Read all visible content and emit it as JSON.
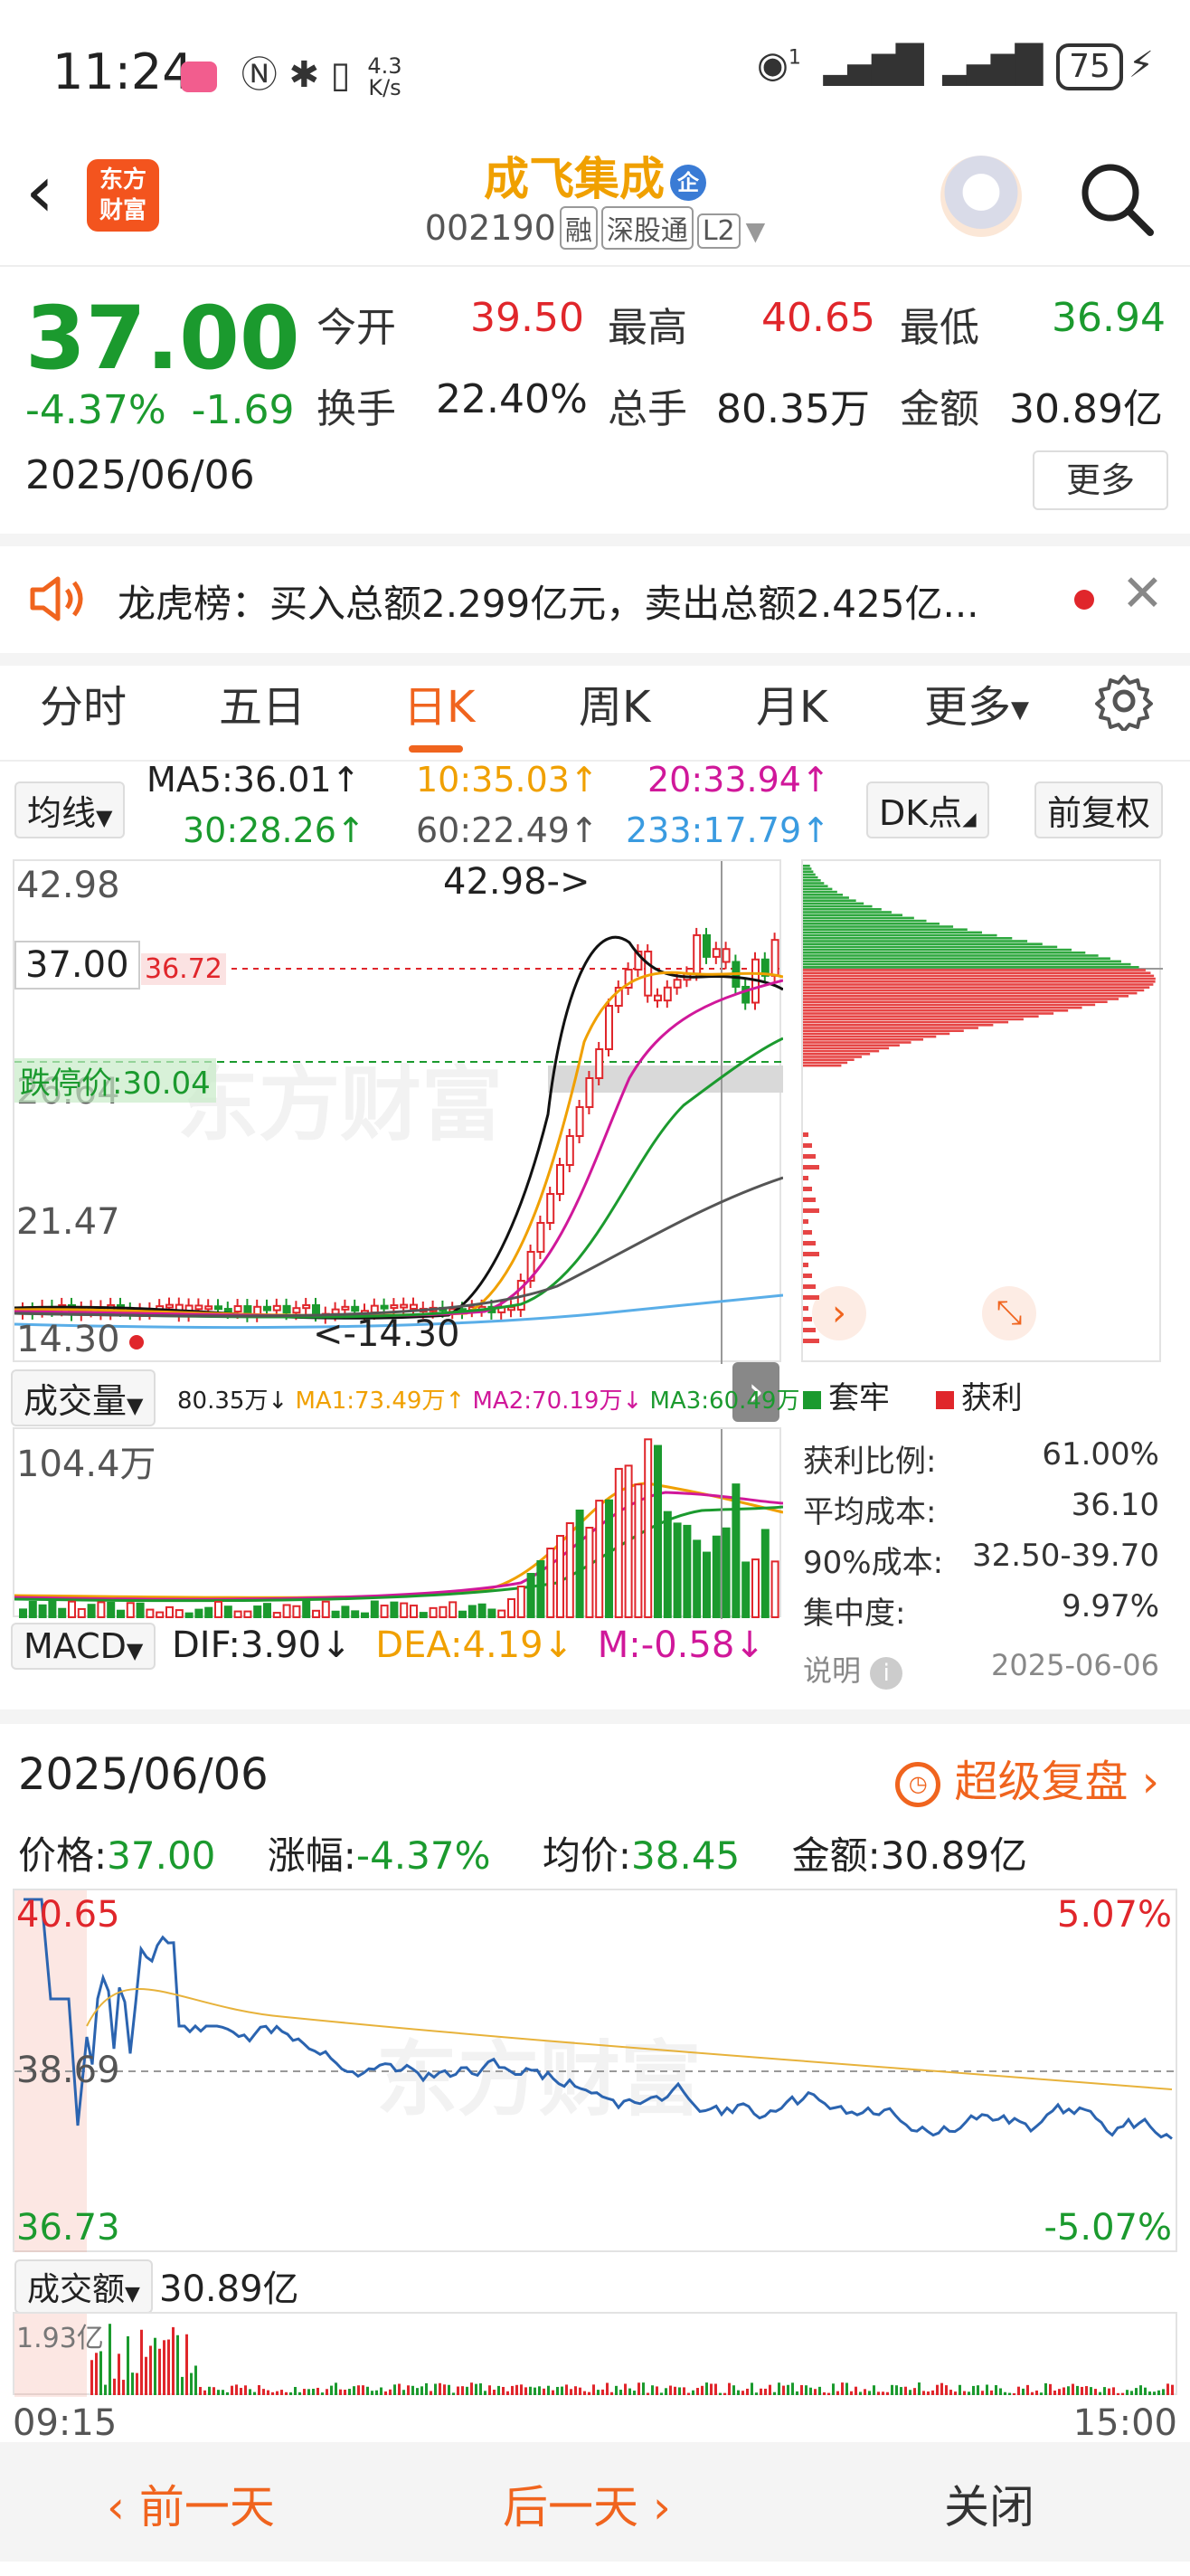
{
  "status_bar": {
    "time": "11:24",
    "speed_value": "4.3",
    "speed_unit": "K/s",
    "signal_tag": "1",
    "battery": "75"
  },
  "header": {
    "logo_line1": "东方",
    "logo_line2": "财富",
    "stock_name": "成飞集成",
    "badge": "企",
    "stock_code": "002190",
    "tags": [
      "融",
      "深股通",
      "L2"
    ]
  },
  "quote": {
    "price": "37.00",
    "change_pct": "-4.37%",
    "change_amt": "-1.69",
    "date": "2025/06/06",
    "open_label": "今开",
    "open": "39.50",
    "high_label": "最高",
    "high": "40.65",
    "low_label": "最低",
    "low": "36.94",
    "turnover_label": "换手",
    "turnover": "22.40%",
    "volume_label": "总手",
    "volume": "80.35万",
    "amount_label": "金额",
    "amount": "30.89亿",
    "more": "更多"
  },
  "news": {
    "text": "龙虎榜：买入总额2.299亿元，卖出总额2.425亿..."
  },
  "tabs": [
    "分时",
    "五日",
    "日K",
    "周K",
    "月K",
    "更多"
  ],
  "kchart": {
    "ma_select": "均线",
    "ma5": "MA5:36.01↑",
    "ma10": "10:35.03↑",
    "ma20": "20:33.94↑",
    "ma30": "30:28.26↑",
    "ma60": "60:22.49↑",
    "ma233": "233:17.79↑",
    "dk_btn": "DK点",
    "fq_btn": "前复权",
    "y_top": "42.98",
    "y_mid1": "26.64",
    "y_mid2": "21.47",
    "y_bottom": "14.30",
    "current_tag": "37.00",
    "current_tag2": "36.72",
    "limit_down": "跌停价:30.04",
    "high_mark": "42.98->",
    "low_mark": "<-14.30",
    "watermark": "东方财富"
  },
  "chip": {
    "legend_locked": "套牢",
    "legend_profit": "获利",
    "stats": [
      {
        "label": "获利比例:",
        "value": "61.00%"
      },
      {
        "label": "平均成本:",
        "value": "36.10"
      },
      {
        "label": "90%成本:",
        "value": "32.50-39.70"
      },
      {
        "label": "集中度:",
        "value": "9.97%"
      }
    ],
    "note": "说明",
    "note_date": "2025-06-06"
  },
  "volume": {
    "select": "成交量",
    "v": "80.35万↓",
    "ma1": "MA1:73.49万↑",
    "ma2": "MA2:70.19万↓",
    "ma3": "MA3:60.49万↑",
    "y_top": "104.4万"
  },
  "macd": {
    "select": "MACD",
    "dif": "DIF:3.90↓",
    "dea": "DEA:4.19↓",
    "m": "M:-0.58↓"
  },
  "intraday": {
    "date": "2025/06/06",
    "replay": "超级复盘",
    "price_label": "价格:",
    "price": "37.00",
    "pct_label": "涨幅:",
    "pct": "-4.37%",
    "avg_label": "均价:",
    "avg": "38.45",
    "amt_label": "金额:",
    "amt": "30.89亿",
    "y_top": "40.65",
    "y_mid": "38.69",
    "y_bot": "36.73",
    "pct_top": "5.07%",
    "pct_bot": "-5.07%",
    "amt_select": "成交额",
    "amt_value": "30.89亿",
    "amt_y_top": "1.93亿",
    "t_start": "09:15",
    "t_end": "15:00"
  },
  "footer": {
    "prev": "前一天",
    "next": "后一天",
    "close": "关闭"
  },
  "colors": {
    "up": "#e0262b",
    "down": "#1b9a2e",
    "accent": "#f0641e",
    "brand": "#f0a000"
  }
}
